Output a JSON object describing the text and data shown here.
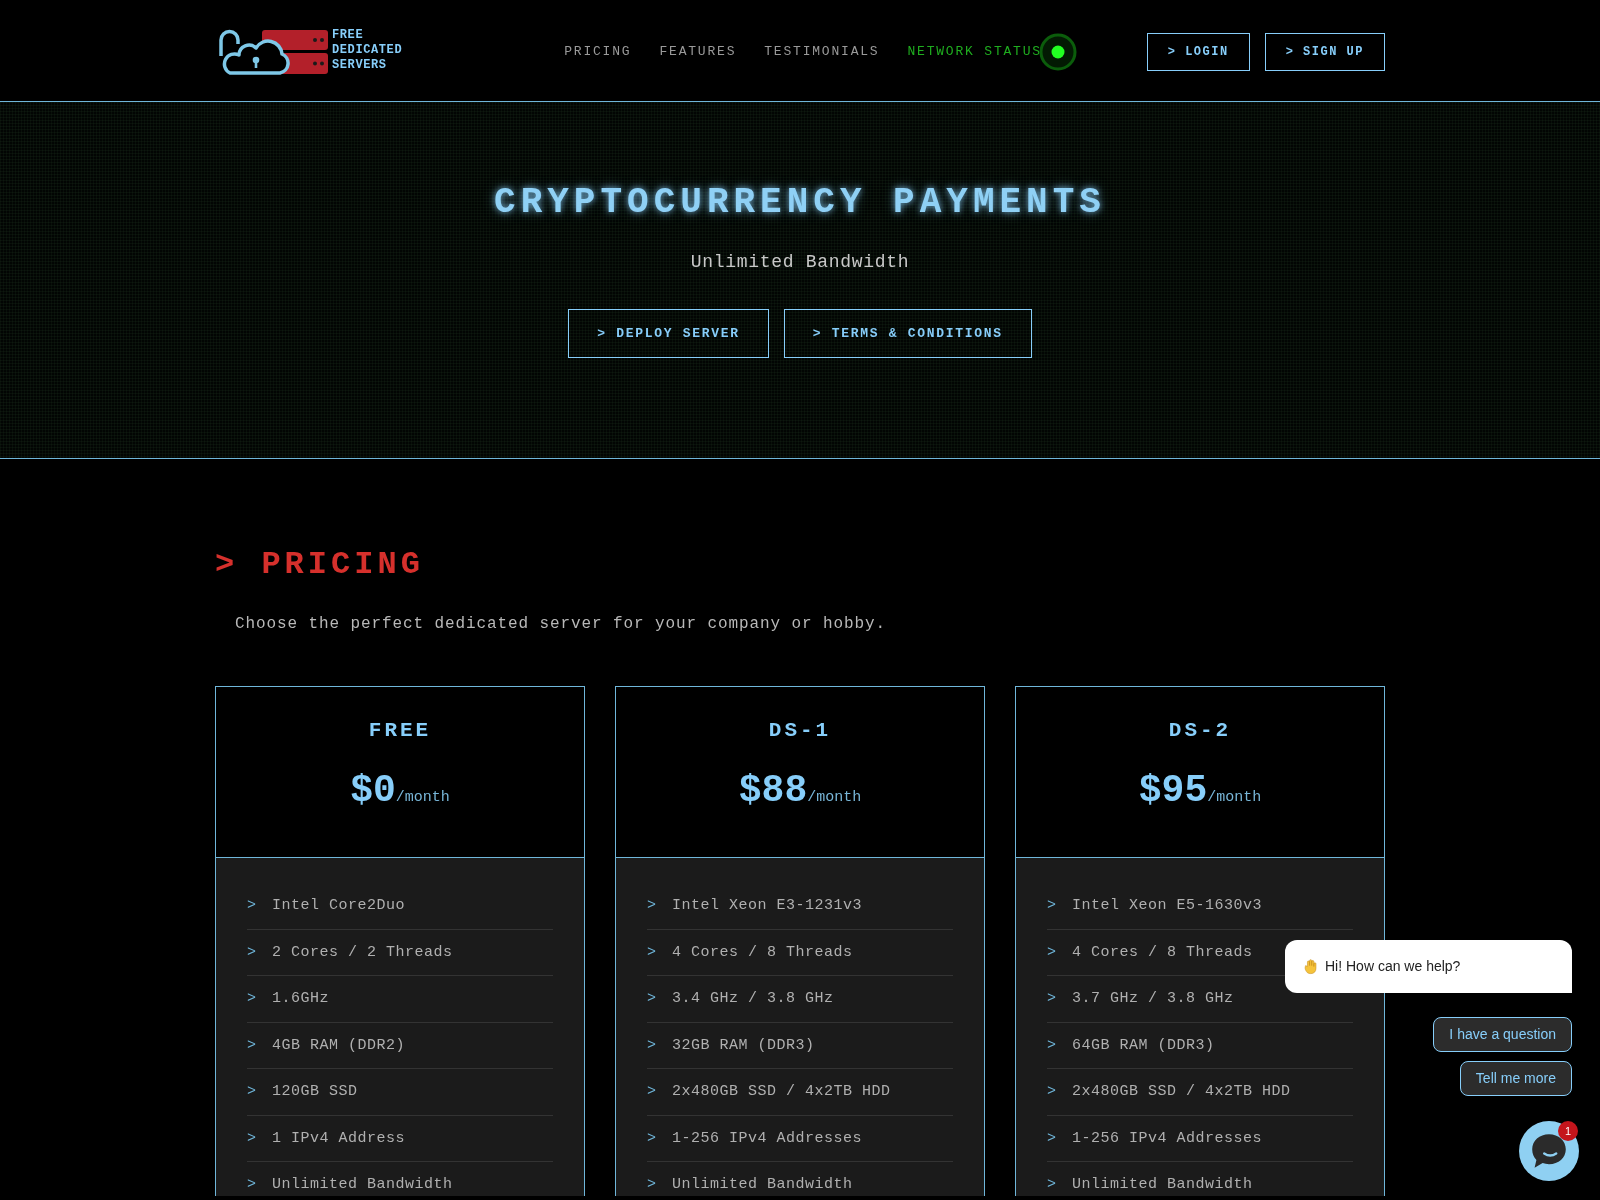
{
  "header": {
    "logo_lines": [
      "FREE",
      "DEDICATED",
      "SERVERS"
    ],
    "nav": [
      {
        "label": "PRICING",
        "kind": "link"
      },
      {
        "label": "FEATURES",
        "kind": "link"
      },
      {
        "label": "TESTIMONIALS",
        "kind": "link"
      },
      {
        "label": "NETWORK STATUS",
        "kind": "status"
      }
    ],
    "buttons": [
      "> LOGIN",
      "> SIGN UP"
    ]
  },
  "hero": {
    "title": "CRYPTOCURRENCY PAYMENTS",
    "subtitle": "Unlimited Bandwidth",
    "buttons": [
      "> DEPLOY SERVER",
      "> TERMS & CONDITIONS"
    ]
  },
  "pricing": {
    "heading": "> PRICING",
    "subtitle": "Choose the perfect dedicated server for your company or hobby.",
    "plans": [
      {
        "name": "FREE",
        "price": "$0",
        "period": "/month",
        "features": [
          {
            "marker": ">",
            "text": "Intel Core2Duo"
          },
          {
            "marker": ">",
            "text": "2 Cores / 2 Threads"
          },
          {
            "marker": ">",
            "text": "1.6GHz"
          },
          {
            "marker": ">",
            "text": "4GB RAM (DDR2)"
          },
          {
            "marker": ">",
            "text": "120GB SSD"
          },
          {
            "marker": ">",
            "text": "1 IPv4 Address"
          },
          {
            "marker": ">",
            "text": "Unlimited Bandwidth"
          }
        ]
      },
      {
        "name": "DS-1",
        "price": "$88",
        "period": "/month",
        "features": [
          {
            "marker": ">",
            "text": "Intel Xeon E3-1231v3"
          },
          {
            "marker": ">",
            "text": "4 Cores / 8 Threads"
          },
          {
            "marker": ">",
            "text": "3.4 GHz / 3.8 GHz"
          },
          {
            "marker": ">",
            "text": "32GB RAM (DDR3)"
          },
          {
            "marker": ">",
            "text": "2x480GB SSD / 4x2TB HDD"
          },
          {
            "marker": ">",
            "text": "1-256 IPv4 Addresses"
          },
          {
            "marker": ">",
            "text": "Unlimited Bandwidth"
          }
        ]
      },
      {
        "name": "DS-2",
        "price": "$95",
        "period": "/month",
        "features": [
          {
            "marker": ">",
            "text": "Intel Xeon E5-1630v3"
          },
          {
            "marker": ">",
            "text": "4 Cores / 8 Threads"
          },
          {
            "marker": ">",
            "text": "3.7 GHz / 3.8 GHz"
          },
          {
            "marker": ">",
            "text": "64GB RAM (DDR3)"
          },
          {
            "marker": ">",
            "text": "2x480GB SSD / 4x2TB HDD"
          },
          {
            "marker": ">",
            "text": "1-256 IPv4 Addresses"
          },
          {
            "marker": ">",
            "text": "Unlimited Bandwidth"
          }
        ]
      }
    ]
  },
  "chat": {
    "greeting": "Hi! How can we help?",
    "quick_replies": [
      "I have a question",
      "Tell me more"
    ],
    "unread": "1"
  }
}
